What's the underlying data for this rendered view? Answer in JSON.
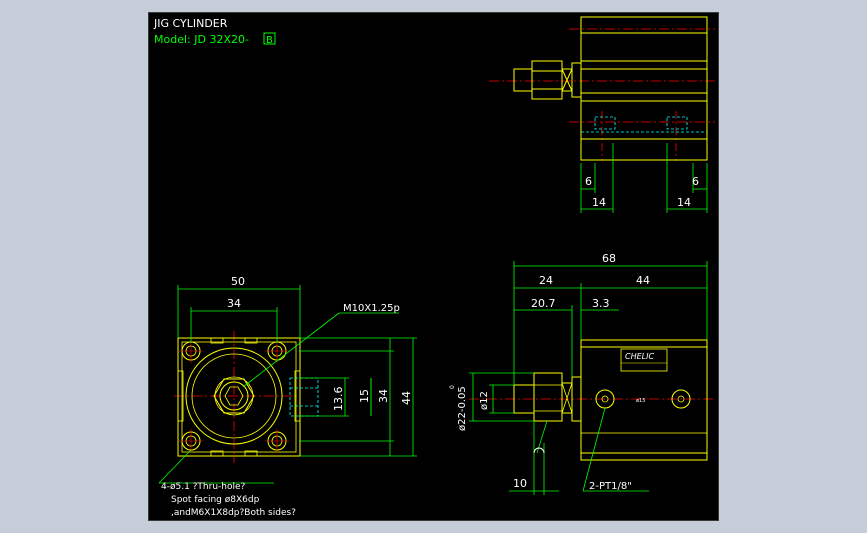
{
  "title_block": {
    "title": "JIG CYLINDER",
    "model_prefix": "Model:  JD  32X20-",
    "model_suffix": "B"
  },
  "front_view": {
    "dim_50": "50",
    "dim_34": "34",
    "thread_callout": "M10X1.25p",
    "dim_13_6": "13.6",
    "dim_15": "15",
    "dim_34_v": "34",
    "dim_44": "44",
    "note_line1": "4-ø5.1 ?Thru-hole?",
    "note_line2": "Spot facing ø8X6dp",
    "note_line3": ",andM6X1X8dp?Both sides?"
  },
  "top_view": {
    "dim_6_left": "6",
    "dim_6_right": "6",
    "dim_14_left": "14",
    "dim_14_right": "14"
  },
  "side_view": {
    "dim_68": "68",
    "dim_24": "24",
    "dim_44": "44",
    "dim_20_7": "20.7",
    "dim_3_3": "3.3",
    "dim_dia22": "ø22-0.05",
    "dim_dia22_upper": "0",
    "dim_dia12": "ø12",
    "dim_10": "10",
    "port_callout": "2-PT1/8\"",
    "label_brand": "CHELIC",
    "small_mark": "ø15"
  },
  "colors": {
    "background": "#000000",
    "outline": "#ffff00",
    "dimension": "#00ff00",
    "center": "#ff0000",
    "hidden": "#00ffff",
    "text": "#ffffff",
    "frame": "#c5cdd8"
  }
}
